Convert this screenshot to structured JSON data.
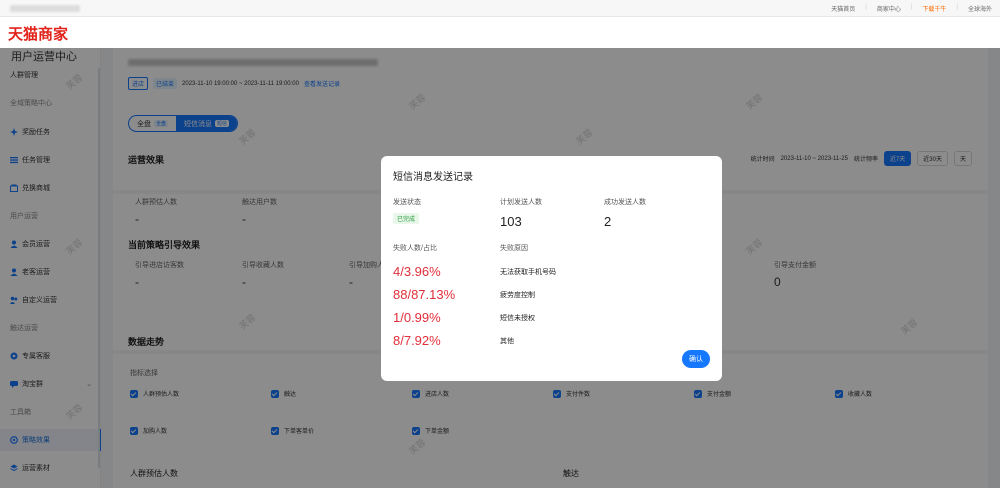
{
  "brand": "天猫商家",
  "topbar": {
    "links": [
      "天猫首页",
      "商家中心",
      "下载千牛",
      "全球海外"
    ]
  },
  "sidebar": {
    "title": "用户运营中心",
    "items": [
      {
        "label": "人群管理",
        "type": "item",
        "icon": ""
      },
      {
        "label": "全域策略中心",
        "type": "group",
        "icon": ""
      },
      {
        "label": "奖励任务",
        "type": "item",
        "icon": "sparkle-icon"
      },
      {
        "label": "任务管理",
        "type": "item",
        "icon": "list-icon"
      },
      {
        "label": "兑换商城",
        "type": "item",
        "icon": "shop-icon"
      },
      {
        "label": "用户运营",
        "type": "group",
        "icon": ""
      },
      {
        "label": "会员运营",
        "type": "item",
        "icon": "member-icon"
      },
      {
        "label": "老客运营",
        "type": "item",
        "icon": "user-icon"
      },
      {
        "label": "自定义运营",
        "type": "item",
        "icon": "custom-icon"
      },
      {
        "label": "触达运营",
        "type": "group",
        "icon": ""
      },
      {
        "label": "专属客服",
        "type": "item",
        "icon": "service-icon"
      },
      {
        "label": "淘宝群",
        "type": "item",
        "icon": "chat-icon"
      },
      {
        "label": "工具箱",
        "type": "group",
        "icon": ""
      },
      {
        "label": "策略效果",
        "type": "item",
        "icon": "target-icon"
      },
      {
        "label": "运营素材",
        "type": "item",
        "icon": "layers-icon"
      }
    ]
  },
  "main": {
    "meta": {
      "tag1": "进店",
      "tag2": "已结束",
      "time": "2023-11-10 19:00:00 ~ 2023-11-11 19:00:00",
      "link": "查看发送记录"
    },
    "segments": [
      {
        "label": "全盘",
        "badge": "全盘"
      },
      {
        "label": "短信消息",
        "badge": "短信"
      }
    ],
    "section1": "运营效果",
    "dates": {
      "label": "统计时间",
      "range": "2023-11-10 ~ 2023-11-25",
      "freq": "统计频率",
      "btns": [
        "近7天",
        "近30天",
        "天"
      ]
    },
    "metrics1": [
      {
        "label": "人群预估人数",
        "value": "-"
      },
      {
        "label": "触达用户数",
        "value": "-"
      }
    ],
    "section2": "当前策略引导效果",
    "metrics2": [
      {
        "label": "引导进店访客数",
        "value": "-"
      },
      {
        "label": "引导收藏人数",
        "value": "-"
      },
      {
        "label": "引导加购人数",
        "value": "-"
      },
      {
        "label": "引导支付金额",
        "value": "0"
      }
    ],
    "section3": "数据走势",
    "indicator_label": "指标选择",
    "checkboxes_row1": [
      "人群预估人数",
      "触达",
      "进店人数",
      "支付件数",
      "支付金额",
      "收藏人数"
    ],
    "checkboxes_row2": [
      "加购人数",
      "下单客单价",
      "下单金额"
    ],
    "bottom_left": "人群预估人数",
    "bottom_right": "触达"
  },
  "modal": {
    "title": "短信消息发送记录",
    "status_label": "发送状态",
    "status_value": "已完成",
    "planned_label": "计划发送人数",
    "planned_value": "103",
    "success_label": "成功发送人数",
    "success_value": "2",
    "fail_label": "失败人数/占比",
    "reason_label": "失败原因",
    "fails": [
      {
        "value": "4/3.96%",
        "reason": "无法获取手机号码"
      },
      {
        "value": "88/87.13%",
        "reason": "疲劳度控制"
      },
      {
        "value": "1/0.99%",
        "reason": "短信未授权"
      },
      {
        "value": "8/7.92%",
        "reason": "其他"
      }
    ],
    "ok_label": "确认"
  },
  "watermark_text": "芙蓉"
}
